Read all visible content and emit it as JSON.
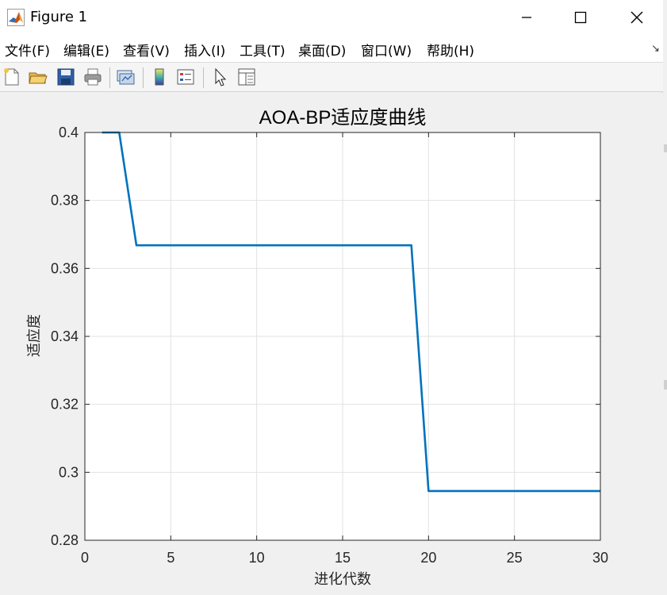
{
  "window": {
    "title": "Figure 1",
    "icons": {
      "app": "matlab-logo-icon",
      "minimize": "minimize-icon",
      "maximize": "maximize-icon",
      "close": "close-icon"
    }
  },
  "menu": {
    "items": [
      "文件(F)",
      "编辑(E)",
      "查看(V)",
      "插入(I)",
      "工具(T)",
      "桌面(D)",
      "窗口(W)",
      "帮助(H)"
    ],
    "dock_icon": "dock-arrow-icon"
  },
  "toolbar": {
    "buttons": [
      "new-figure-icon",
      "open-file-icon",
      "save-icon",
      "print-icon",
      "link-plot-icon",
      "insert-colorbar-icon",
      "insert-legend-icon",
      "select-pointer-icon",
      "property-inspector-icon"
    ]
  },
  "chart_data": {
    "type": "line",
    "title": "AOA-BP适应度曲线",
    "xlabel": "进化代数",
    "ylabel": "适应度",
    "xlim": [
      0,
      30
    ],
    "ylim": [
      0.28,
      0.4
    ],
    "xticks": [
      0,
      5,
      10,
      15,
      20,
      25,
      30
    ],
    "yticks": [
      0.28,
      0.3,
      0.32,
      0.34,
      0.36,
      0.38,
      0.4
    ],
    "xtick_labels": [
      "0",
      "5",
      "10",
      "15",
      "20",
      "25",
      "30"
    ],
    "ytick_labels": [
      "0.28",
      "0.3",
      "0.32",
      "0.34",
      "0.36",
      "0.38",
      "0.4"
    ],
    "grid": true,
    "series": [
      {
        "color": "#0072bd",
        "x": [
          1,
          2,
          3,
          4,
          5,
          6,
          7,
          8,
          9,
          10,
          11,
          12,
          13,
          14,
          15,
          16,
          17,
          18,
          19,
          20,
          21,
          22,
          23,
          24,
          25,
          26,
          27,
          28,
          29,
          30
        ],
        "y": [
          0.4,
          0.4,
          0.3668,
          0.3668,
          0.3668,
          0.3668,
          0.3668,
          0.3668,
          0.3668,
          0.3668,
          0.3668,
          0.3668,
          0.3668,
          0.3668,
          0.3668,
          0.3668,
          0.3668,
          0.3668,
          0.3668,
          0.2945,
          0.2945,
          0.2945,
          0.2945,
          0.2945,
          0.2945,
          0.2945,
          0.2945,
          0.2945,
          0.2945,
          0.2945
        ]
      }
    ]
  }
}
